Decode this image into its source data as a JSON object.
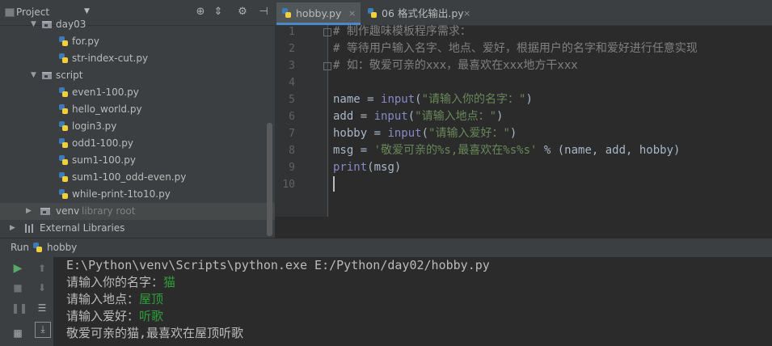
{
  "project": {
    "title": "Project",
    "tree": [
      {
        "label": "day03",
        "type": "folder"
      },
      {
        "label": "for.py",
        "type": "file"
      },
      {
        "label": "str-index-cut.py",
        "type": "file"
      },
      {
        "label": "script",
        "type": "folder"
      },
      {
        "label": "even1-100.py",
        "type": "file"
      },
      {
        "label": "hello_world.py",
        "type": "file"
      },
      {
        "label": "login3.py",
        "type": "file"
      },
      {
        "label": "odd1-100.py",
        "type": "file"
      },
      {
        "label": "sum1-100.py",
        "type": "file"
      },
      {
        "label": "sum1-100_odd-even.py",
        "type": "file"
      },
      {
        "label": "while-print-1to10.py",
        "type": "file"
      },
      {
        "label": "venv",
        "extra": "library root",
        "type": "folder"
      },
      {
        "label": "External Libraries",
        "type": "library"
      }
    ]
  },
  "tabs": [
    {
      "label": "hobby.py",
      "active": true
    },
    {
      "label": "06 格式化输出.py",
      "active": false
    }
  ],
  "editor": {
    "line_numbers": [
      "1",
      "2",
      "3",
      "4",
      "5",
      "6",
      "7",
      "8",
      "9",
      "10"
    ],
    "lines": {
      "l1": "# 制作趣味模板程序需求：",
      "l2": "# 等待用户输入名字、地点、爱好，根据用户的名字和爱好进行任意实现",
      "l3": "# 如：敬爱可亲的xxx，最喜欢在xxx地方干xxx",
      "l5a": "name = ",
      "l5b": "input",
      "l5c": "(",
      "l5d": "\"请输入你的名字：\"",
      "l5e": ")",
      "l6a": "add = ",
      "l6b": "input",
      "l6c": "(",
      "l6d": "\"请输入地点：\"",
      "l6e": ")",
      "l7a": "hobby = ",
      "l7b": "input",
      "l7c": "(",
      "l7d": "\"请输入爱好：\"",
      "l7e": ")",
      "l8a": "msg = ",
      "l8b": "'敬爱可亲的%s,最喜欢在%s%s'",
      "l8c": " % (name, add, hobby)",
      "l9a": "print",
      "l9b": "(msg)"
    }
  },
  "run": {
    "label": "Run",
    "config": "hobby",
    "console": {
      "command": "E:\\Python\\venv\\Scripts\\python.exe E:/Python/day02/hobby.py",
      "p1": "请输入你的名字：",
      "i1": "猫",
      "p2": "请输入地点：",
      "i2": "屋顶",
      "p3": "请输入爱好：",
      "i3": "听歌",
      "result": "敬爱可亲的猫,最喜欢在屋顶听歌"
    }
  },
  "colors": {
    "comment": "#808080",
    "string": "#6a8759",
    "builtin": "#8888c6",
    "console_input": "#2f9d3a"
  }
}
